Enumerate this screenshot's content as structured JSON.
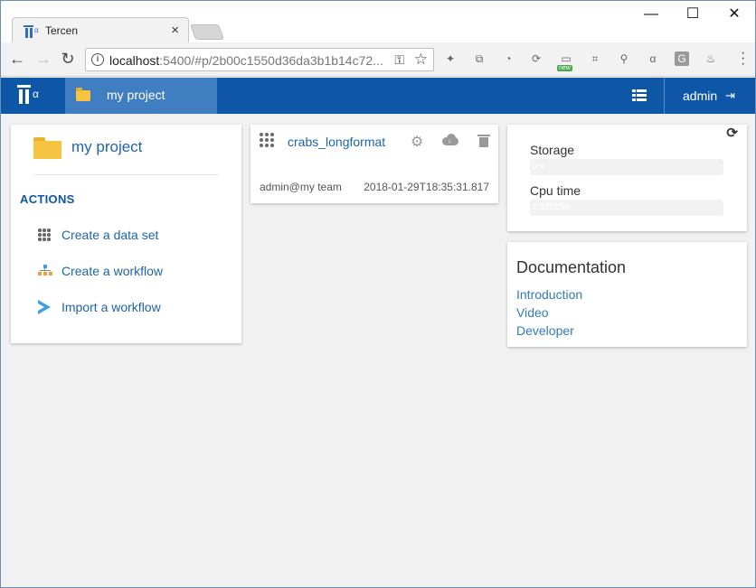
{
  "browser": {
    "tab_title": "Tercen",
    "tab_close": "×",
    "favicon_alpha": "α",
    "url_host": "localhost",
    "url_path": ":5400/#p/2b00c1550d36da3b1b14c72...",
    "window_controls": {
      "minimize": "—",
      "maximize": "☐",
      "close": "✕"
    },
    "ext_new_badge": "new"
  },
  "appbar": {
    "logo_alpha": "α",
    "breadcrumb": "my project",
    "user": "admin"
  },
  "project": {
    "title": "my project",
    "actions_heading": "ACTIONS",
    "actions": [
      {
        "label": "Create a data set",
        "icon": "grid-icon"
      },
      {
        "label": "Create a workflow",
        "icon": "workflow-tree-icon"
      },
      {
        "label": "Import a workflow",
        "icon": "chevron-right-icon"
      }
    ]
  },
  "dataset": {
    "name": "crabs_longformat",
    "owner": "admin@my team",
    "date": "2018-01-29T18:35:31.817"
  },
  "usage": {
    "storage_label": "Storage",
    "storage_value": "0%",
    "storage_fraction": 0.0,
    "cpu_label": "Cpu time",
    "cpu_value": "1.32015e-",
    "cpu_fraction": 0.0
  },
  "docs": {
    "title": "Documentation",
    "links": [
      "Introduction",
      "Video",
      "Developer"
    ]
  },
  "colors": {
    "appbar": "#0e56a6",
    "breadcrumb_bg": "#3f7ec1",
    "link": "#1e63b0",
    "folder": "#f5c542"
  }
}
